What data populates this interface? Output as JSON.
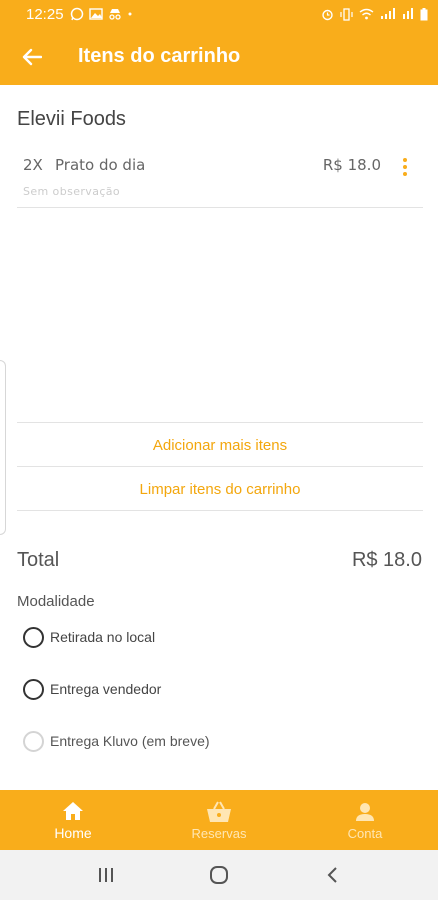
{
  "status_bar": {
    "time": "12:25"
  },
  "app_bar": {
    "title": "Itens do carrinho"
  },
  "store": {
    "name": "Elevii Foods"
  },
  "cart_items": [
    {
      "qty": "2X",
      "name": "Prato do dia",
      "price": "R$ 18.0",
      "note": "Sem observação"
    }
  ],
  "actions": {
    "add_more": "Adicionar mais itens",
    "clear_cart": "Limpar itens do carrinho"
  },
  "total": {
    "label": "Total",
    "value": "R$ 18.0"
  },
  "modality": {
    "label": "Modalidade",
    "options": [
      {
        "label": "Retirada no local",
        "enabled": true
      },
      {
        "label": "Entrega vendedor",
        "enabled": true
      },
      {
        "label": "Entrega Kluvo (em breve)",
        "enabled": false
      }
    ]
  },
  "bottom_nav": {
    "items": [
      {
        "label": "Home",
        "icon": "home-icon",
        "active": true
      },
      {
        "label": "Reservas",
        "icon": "basket-icon",
        "active": false
      },
      {
        "label": "Conta",
        "icon": "person-icon",
        "active": false
      }
    ]
  },
  "colors": {
    "accent": "#f9ad1b",
    "link": "#f3a70e"
  }
}
